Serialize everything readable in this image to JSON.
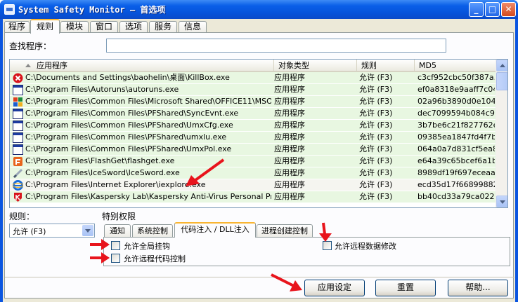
{
  "window": {
    "title": "System Safety Monitor — 首选项",
    "minimize": "_",
    "maximize": "□",
    "close": "✕"
  },
  "tabs": [
    "程序",
    "规则",
    "模块",
    "窗口",
    "选项",
    "服务",
    "信息"
  ],
  "search": {
    "label": "查找程序：",
    "value": ""
  },
  "list": {
    "columns": [
      "应用程序",
      "对象类型",
      "规则",
      "MD5"
    ],
    "rows": [
      {
        "icon": "killbox-icon",
        "path": "C:\\Documents and Settings\\baohelin\\桌面\\KillBox.exe",
        "type": "应用程序",
        "rule": "允许 (F3)",
        "md5": "c3cf952cbc50f387a..."
      },
      {
        "icon": "app-window-icon",
        "path": "C:\\Program Files\\Autoruns\\autoruns.exe",
        "type": "应用程序",
        "rule": "允许 (F3)",
        "md5": "ef0a8318e9aaff7c04..."
      },
      {
        "icon": "office-icon",
        "path": "C:\\Program Files\\Common Files\\Microsoft Shared\\OFFICE11\\MSOXM...",
        "type": "应用程序",
        "rule": "允许 (F3)",
        "md5": "02a96b3890d0e104..."
      },
      {
        "icon": "app-window-icon",
        "path": "C:\\Program Files\\Common Files\\PFShared\\SyncEvnt.exe",
        "type": "应用程序",
        "rule": "允许 (F3)",
        "md5": "dec7099594b084c9..."
      },
      {
        "icon": "app-window-icon",
        "path": "C:\\Program Files\\Common Files\\PFShared\\UmxCfg.exe",
        "type": "应用程序",
        "rule": "允许 (F3)",
        "md5": "3b7be6c21f827762e..."
      },
      {
        "icon": "app-window-icon",
        "path": "C:\\Program Files\\Common Files\\PFShared\\umxlu.exe",
        "type": "应用程序",
        "rule": "允许 (F3)",
        "md5": "09385ea1847fd4f7b..."
      },
      {
        "icon": "app-window-icon",
        "path": "C:\\Program Files\\Common Files\\PFShared\\UmxPol.exe",
        "type": "应用程序",
        "rule": "允许 (F3)",
        "md5": "064a0a7d831cf5ea8..."
      },
      {
        "icon": "flashget-icon",
        "path": "C:\\Program Files\\FlashGet\\flashget.exe",
        "type": "应用程序",
        "rule": "允许 (F3)",
        "md5": "e64a39c65bcef6a1b..."
      },
      {
        "icon": "icesword-icon",
        "path": "C:\\Program Files\\IceSword\\IceSword.exe",
        "type": "应用程序",
        "rule": "允许 (F3)",
        "md5": "8989df19f697eceaa..."
      },
      {
        "icon": "ie-icon",
        "path": "C:\\Program Files\\Internet Explorer\\iexplore.exe",
        "type": "应用程序",
        "rule": "允许 (F3)",
        "md5": "ecd35d17f66899882..."
      },
      {
        "icon": "kaspersky-icon",
        "path": "C:\\Program Files\\Kaspersky Lab\\Kaspersky Anti-Virus Personal Pro\\ka...",
        "type": "应用程序",
        "rule": "允许 (F3)",
        "md5": "bb40cd33a79ca022..."
      }
    ]
  },
  "rule": {
    "label": "规则：",
    "selected": "允许 (F3)"
  },
  "permissions": {
    "label": "特别权限",
    "tabs": [
      "通知",
      "系统控制",
      "代码注入 / DLL注入",
      "进程创建控制"
    ],
    "checkboxes": [
      "允许全局挂钩",
      "允许远程代码控制",
      "允许远程数据修改"
    ]
  },
  "buttons": {
    "apply": "应用设定",
    "reset": "重置",
    "help": "帮助..."
  },
  "colors": {
    "title_bar": "#0a5fe8",
    "row_green": "#e8f7e1",
    "annotation_arrow": "#e8141c",
    "tab_highlight": "#f9b532"
  }
}
